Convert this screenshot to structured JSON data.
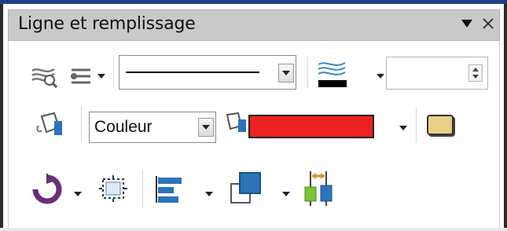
{
  "panel": {
    "title": "Ligne et remplissage"
  },
  "row1": {
    "line_style_value": "solid",
    "line_width_value": ""
  },
  "row2": {
    "area_style_value": "Couleur",
    "fill_color": "#ee2222"
  },
  "icons": {
    "menu": "triangle-down",
    "close": "close-x",
    "line-properties": "line-properties",
    "arrow-style": "arrow-style",
    "line-color": "line-color",
    "fill-bucket": "fill-bucket",
    "fill-color": "fill-color",
    "shadow": "shadow",
    "rotate": "rotate",
    "transform": "transform",
    "align": "align",
    "arrange": "arrange",
    "distribute": "distribute"
  },
  "colors": {
    "accent": "#1f3f8a",
    "title_bar": "#c9c9c9",
    "line_color_swatch": "#000000",
    "rotate_purple": "#6a2e78",
    "align_blue": "#2b74b9",
    "distribute_orange": "#e38a1a",
    "distribute_green": "#7cc33a"
  }
}
